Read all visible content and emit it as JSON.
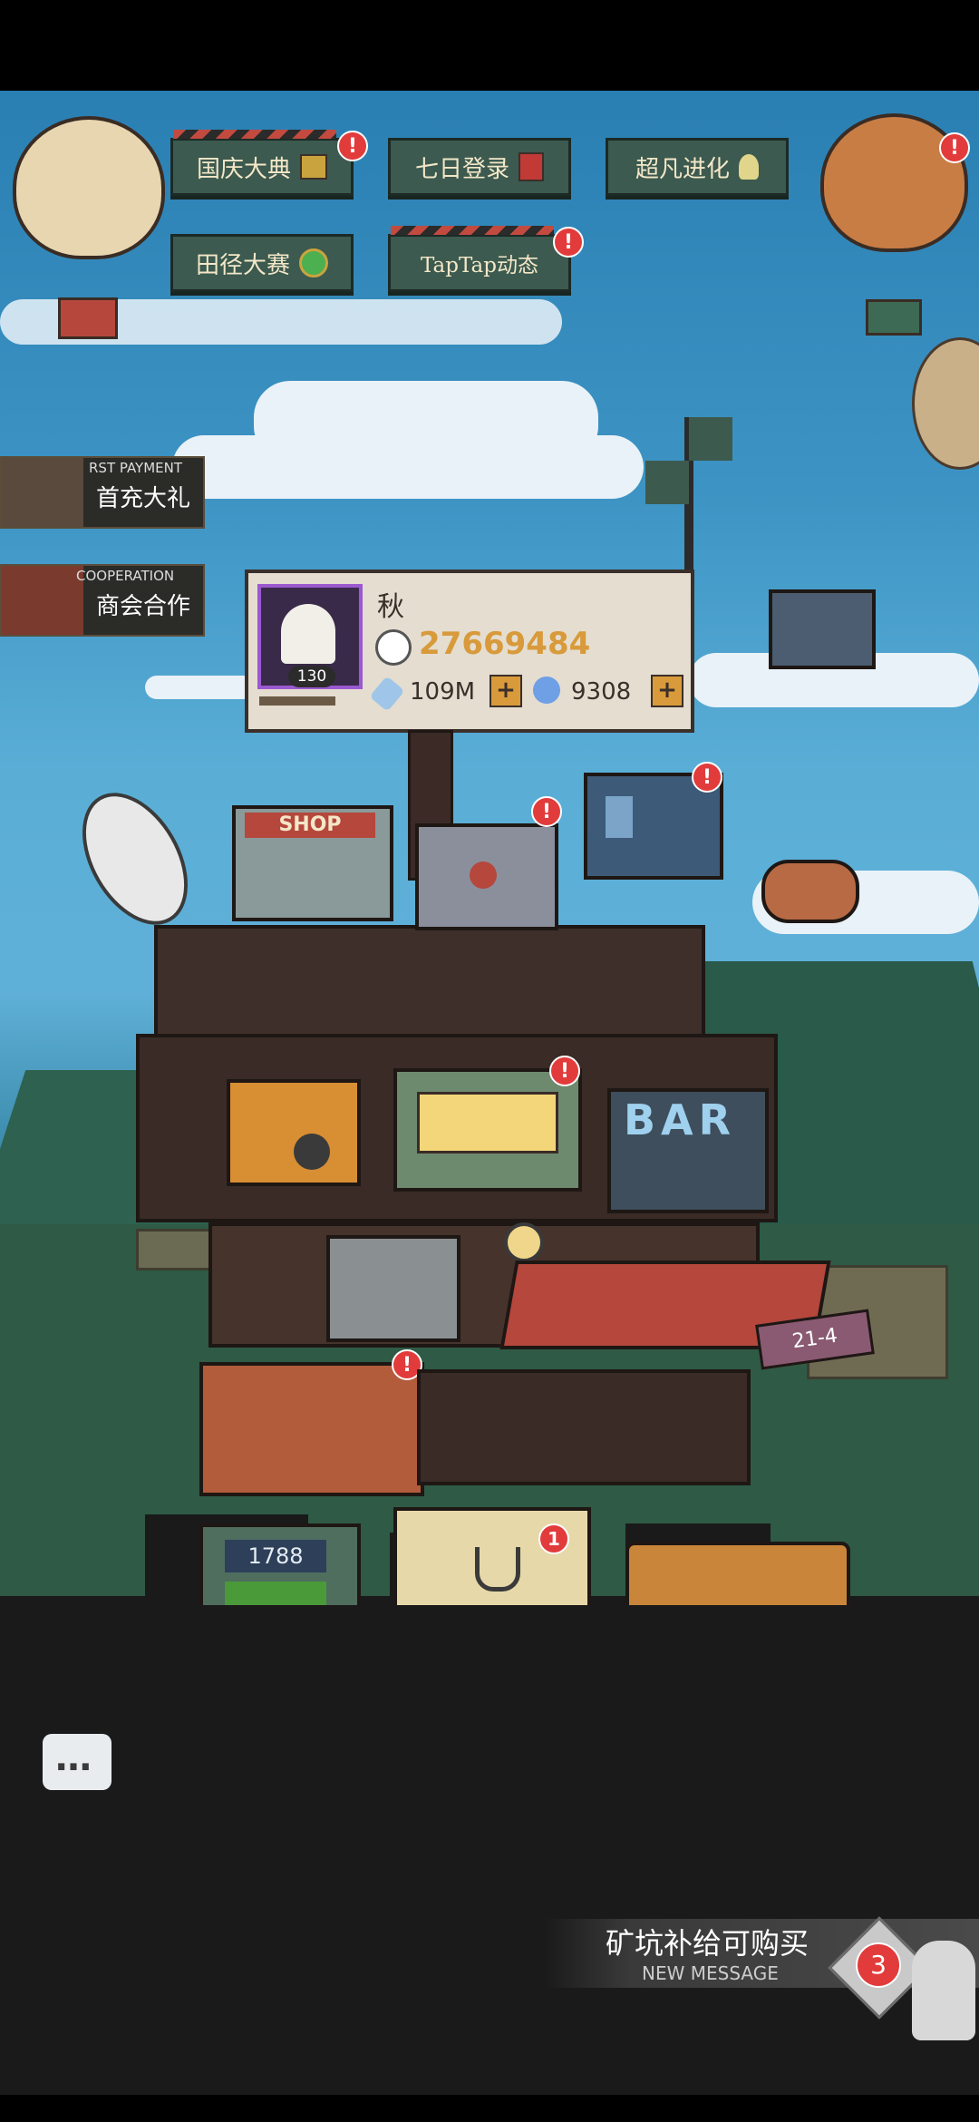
{
  "top_banners": [
    {
      "label": "国庆大典",
      "alert": "!"
    },
    {
      "label": "七日登录",
      "alert": ""
    },
    {
      "label": "超凡进化",
      "alert": ""
    },
    {
      "label": "田径大赛",
      "alert": ""
    },
    {
      "label": "TapTap动态",
      "alert": "!"
    }
  ],
  "balloon_alert": "!",
  "side_banners": [
    {
      "label": "首充大礼",
      "sub": "RST PAYMENT"
    },
    {
      "label": "商会合作",
      "sub": "COOPERATION"
    }
  ],
  "player": {
    "name": "秋",
    "level": "130",
    "power": "27669484",
    "currency1": "109M",
    "currency2": "9308",
    "plus": "+"
  },
  "buildings": {
    "shop_label": "SHOP",
    "bar_label": "BAR",
    "stage_label": "21-4",
    "counter_value": "1788",
    "claw_badge": "1",
    "alert": "!"
  },
  "message": {
    "text": "矿坑补给可购买",
    "sub": "NEW MESSAGE",
    "count": "3"
  },
  "chat_icon": "…"
}
